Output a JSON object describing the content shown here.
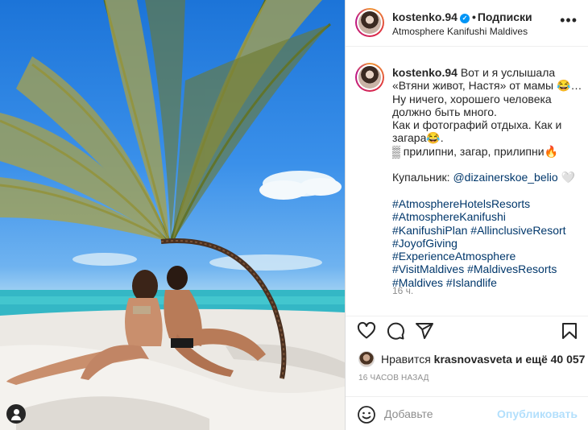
{
  "post": {
    "username": "kostenko.94",
    "separator": "•",
    "follow_label": "Подписки",
    "location": "Atmosphere Kanifushi Maldives",
    "more_label": "•••"
  },
  "caption": {
    "username": "kostenko.94",
    "text": "Вот и я услышала «Втяни живот, Настя» от мамы 😂… Ну ничего, хорошего человека должно быть много.\nКак и фотографий отдыха. Как и загара😂.\n▒ прилипни, загар, прилипни🔥\n\nКупальник: ",
    "mention": "@dizainerskoe_belio",
    "after_mention": " 🤍",
    "hashtags": "#AtmosphereHotelsResorts #AtmosphereKanifushi #KanifushiPlan #AllinclusiveResort #JoyofGiving #ExperienceAtmosphere #VisitMaldives #MaldivesResorts #Maldives #Islandlife",
    "time_ago": "16 ч."
  },
  "likes": {
    "prefix": "Нравится ",
    "user": "krasnovasveta",
    "suffix": " и ещё 40 057"
  },
  "timestamp": "16 ЧАСОВ НАЗАД",
  "comment": {
    "placeholder": "Добавьте",
    "publish_label": "Опубликовать"
  },
  "icons": {
    "like": "heart-icon",
    "comment": "comment-icon",
    "share": "paper-plane-icon",
    "save": "bookmark-icon",
    "emoji": "smiley-icon",
    "tag": "user-tag-icon"
  },
  "colors": {
    "link": "#00376b",
    "verified": "#0095f6",
    "publish_disabled": "#b2dffc",
    "secondary_text": "#8e8e8e"
  }
}
